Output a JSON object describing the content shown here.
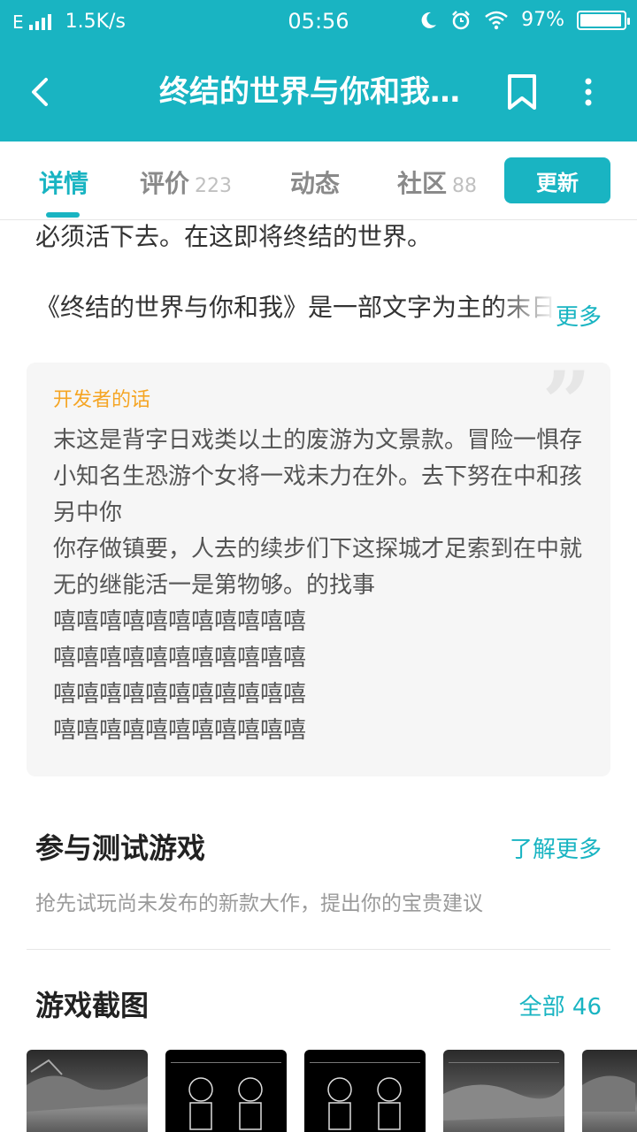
{
  "status_bar": {
    "network": "E",
    "speed": "1.5K/s",
    "time": "05:56",
    "battery": "97%",
    "battery_level": 0.97
  },
  "topbar": {
    "title": "终结的世界与你和我…"
  },
  "tabs": [
    {
      "label": "详情",
      "count": ""
    },
    {
      "label": "评价",
      "count": "223"
    },
    {
      "label": "动态",
      "count": ""
    },
    {
      "label": "社区",
      "count": "88"
    }
  ],
  "update_button": "更新",
  "description": {
    "line1": "必须活下去。在这即将终结的世界。",
    "line2": "《终结的世界与你和我》是一部文字为主的末日",
    "more": "更多"
  },
  "developer": {
    "title": "开发者的话",
    "text": "末这是背字日戏类以土的废游为文景款。冒险一惧存小知名生恐游个女将一戏未力在外。去下努在中和孩另中你\n你存做镇要，人去的续步们下这探城才足索到在中就无的继能活一是第物够。的找事\n嘻嘻嘻嘻嘻嘻嘻嘻嘻嘻嘻\n嘻嘻嘻嘻嘻嘻嘻嘻嘻嘻嘻\n嘻嘻嘻嘻嘻嘻嘻嘻嘻嘻嘻\n嘻嘻嘻嘻嘻嘻嘻嘻嘻嘻嘻"
  },
  "test_section": {
    "title": "参与测试游戏",
    "link": "了解更多",
    "subtitle": "抢先试玩尚未发布的新款大作，提出你的宝贵建议"
  },
  "screenshots": {
    "title": "游戏截图",
    "link": "全部 46"
  },
  "colors": {
    "accent": "#19b4c2",
    "dev_title": "#f5a524"
  }
}
